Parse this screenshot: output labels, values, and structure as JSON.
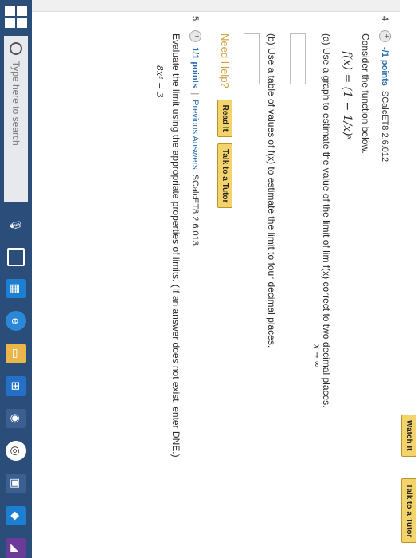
{
  "header": {
    "watch_label": "Watch It",
    "tutor_label": "Talk to a Tutor"
  },
  "q4": {
    "number": "4.",
    "points": "-/1 points",
    "code": "SCalcET8 2.6.012.",
    "intro": "Consider the function below.",
    "function_text": "f(x) = (1 − 1/x)ˣ",
    "part_a": "(a) Use a graph to estimate the value of the limit of  lim f(x)  correct to two decimal places.",
    "part_a_sub": "x → ∞",
    "part_b": "(b) Use a table of values of f(x) to estimate the limit to four decimal places.",
    "need_help": "Need Help?",
    "read_label": "Read It",
    "tutor_label": "Talk to a Tutor"
  },
  "q5": {
    "number": "5.",
    "points": "1/1 points",
    "prev_answers": "Previous Answers",
    "code": "SCalcET8 2.6.013.",
    "instruction": "Evaluate the limit using the appropriate properties of limits. (If an answer does not exist, enter DNE.)",
    "math_fragment": "8x² − 3"
  },
  "taskbar": {
    "search_placeholder": "Type here to search"
  }
}
